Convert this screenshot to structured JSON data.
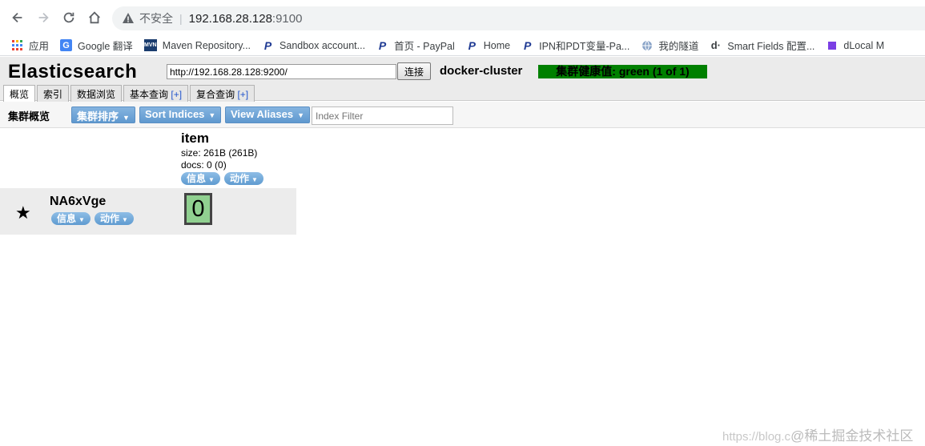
{
  "browser": {
    "security_label": "不安全",
    "url_host": "192.168.28.128",
    "url_port": ":9100",
    "bookmarks": [
      {
        "icon": "apps-grid-icon",
        "label": "应用"
      },
      {
        "icon": "google-translate-icon",
        "label": "Google 翻译"
      },
      {
        "icon": "maven-icon",
        "label": "Maven Repository..."
      },
      {
        "icon": "paypal-icon",
        "label": "Sandbox account..."
      },
      {
        "icon": "paypal-icon",
        "label": "首页 - PayPal"
      },
      {
        "icon": "paypal-icon",
        "label": "Home"
      },
      {
        "icon": "paypal-icon",
        "label": "IPN和PDT变量-Pa..."
      },
      {
        "icon": "globe-icon",
        "label": "我的隧道"
      },
      {
        "icon": "dlocal-icon",
        "label": "Smart Fields 配置..."
      },
      {
        "icon": "purple-square-icon",
        "label": "dLocal M"
      }
    ]
  },
  "header": {
    "title": "Elasticsearch",
    "connect_url": "http://192.168.28.128:9200/",
    "connect_label": "连接",
    "cluster_name": "docker-cluster",
    "health": "集群健康值: green (1 of 1)",
    "health_color": "#008000"
  },
  "tabs": [
    {
      "label": "概览",
      "plus": ""
    },
    {
      "label": "索引",
      "plus": ""
    },
    {
      "label": "数据浏览",
      "plus": ""
    },
    {
      "label": "基本查询",
      "plus": "[+]"
    },
    {
      "label": "复合查询",
      "plus": "[+]"
    }
  ],
  "toolbar": {
    "title": "集群概览",
    "sort_cluster": "集群排序",
    "sort_indices": "Sort Indices",
    "view_aliases": "View Aliases",
    "filter_placeholder": "Index Filter"
  },
  "index": {
    "name": "item",
    "size": "size: 261B (261B)",
    "docs": "docs: 0 (0)",
    "info_label": "信息",
    "action_label": "动作"
  },
  "node": {
    "name": "NA6xVge",
    "info_label": "信息",
    "action_label": "动作",
    "shard": "0",
    "shard_color": "#90d090"
  },
  "watermark": {
    "url": "https://blog.c",
    "text": "@稀土掘金技术社区"
  }
}
